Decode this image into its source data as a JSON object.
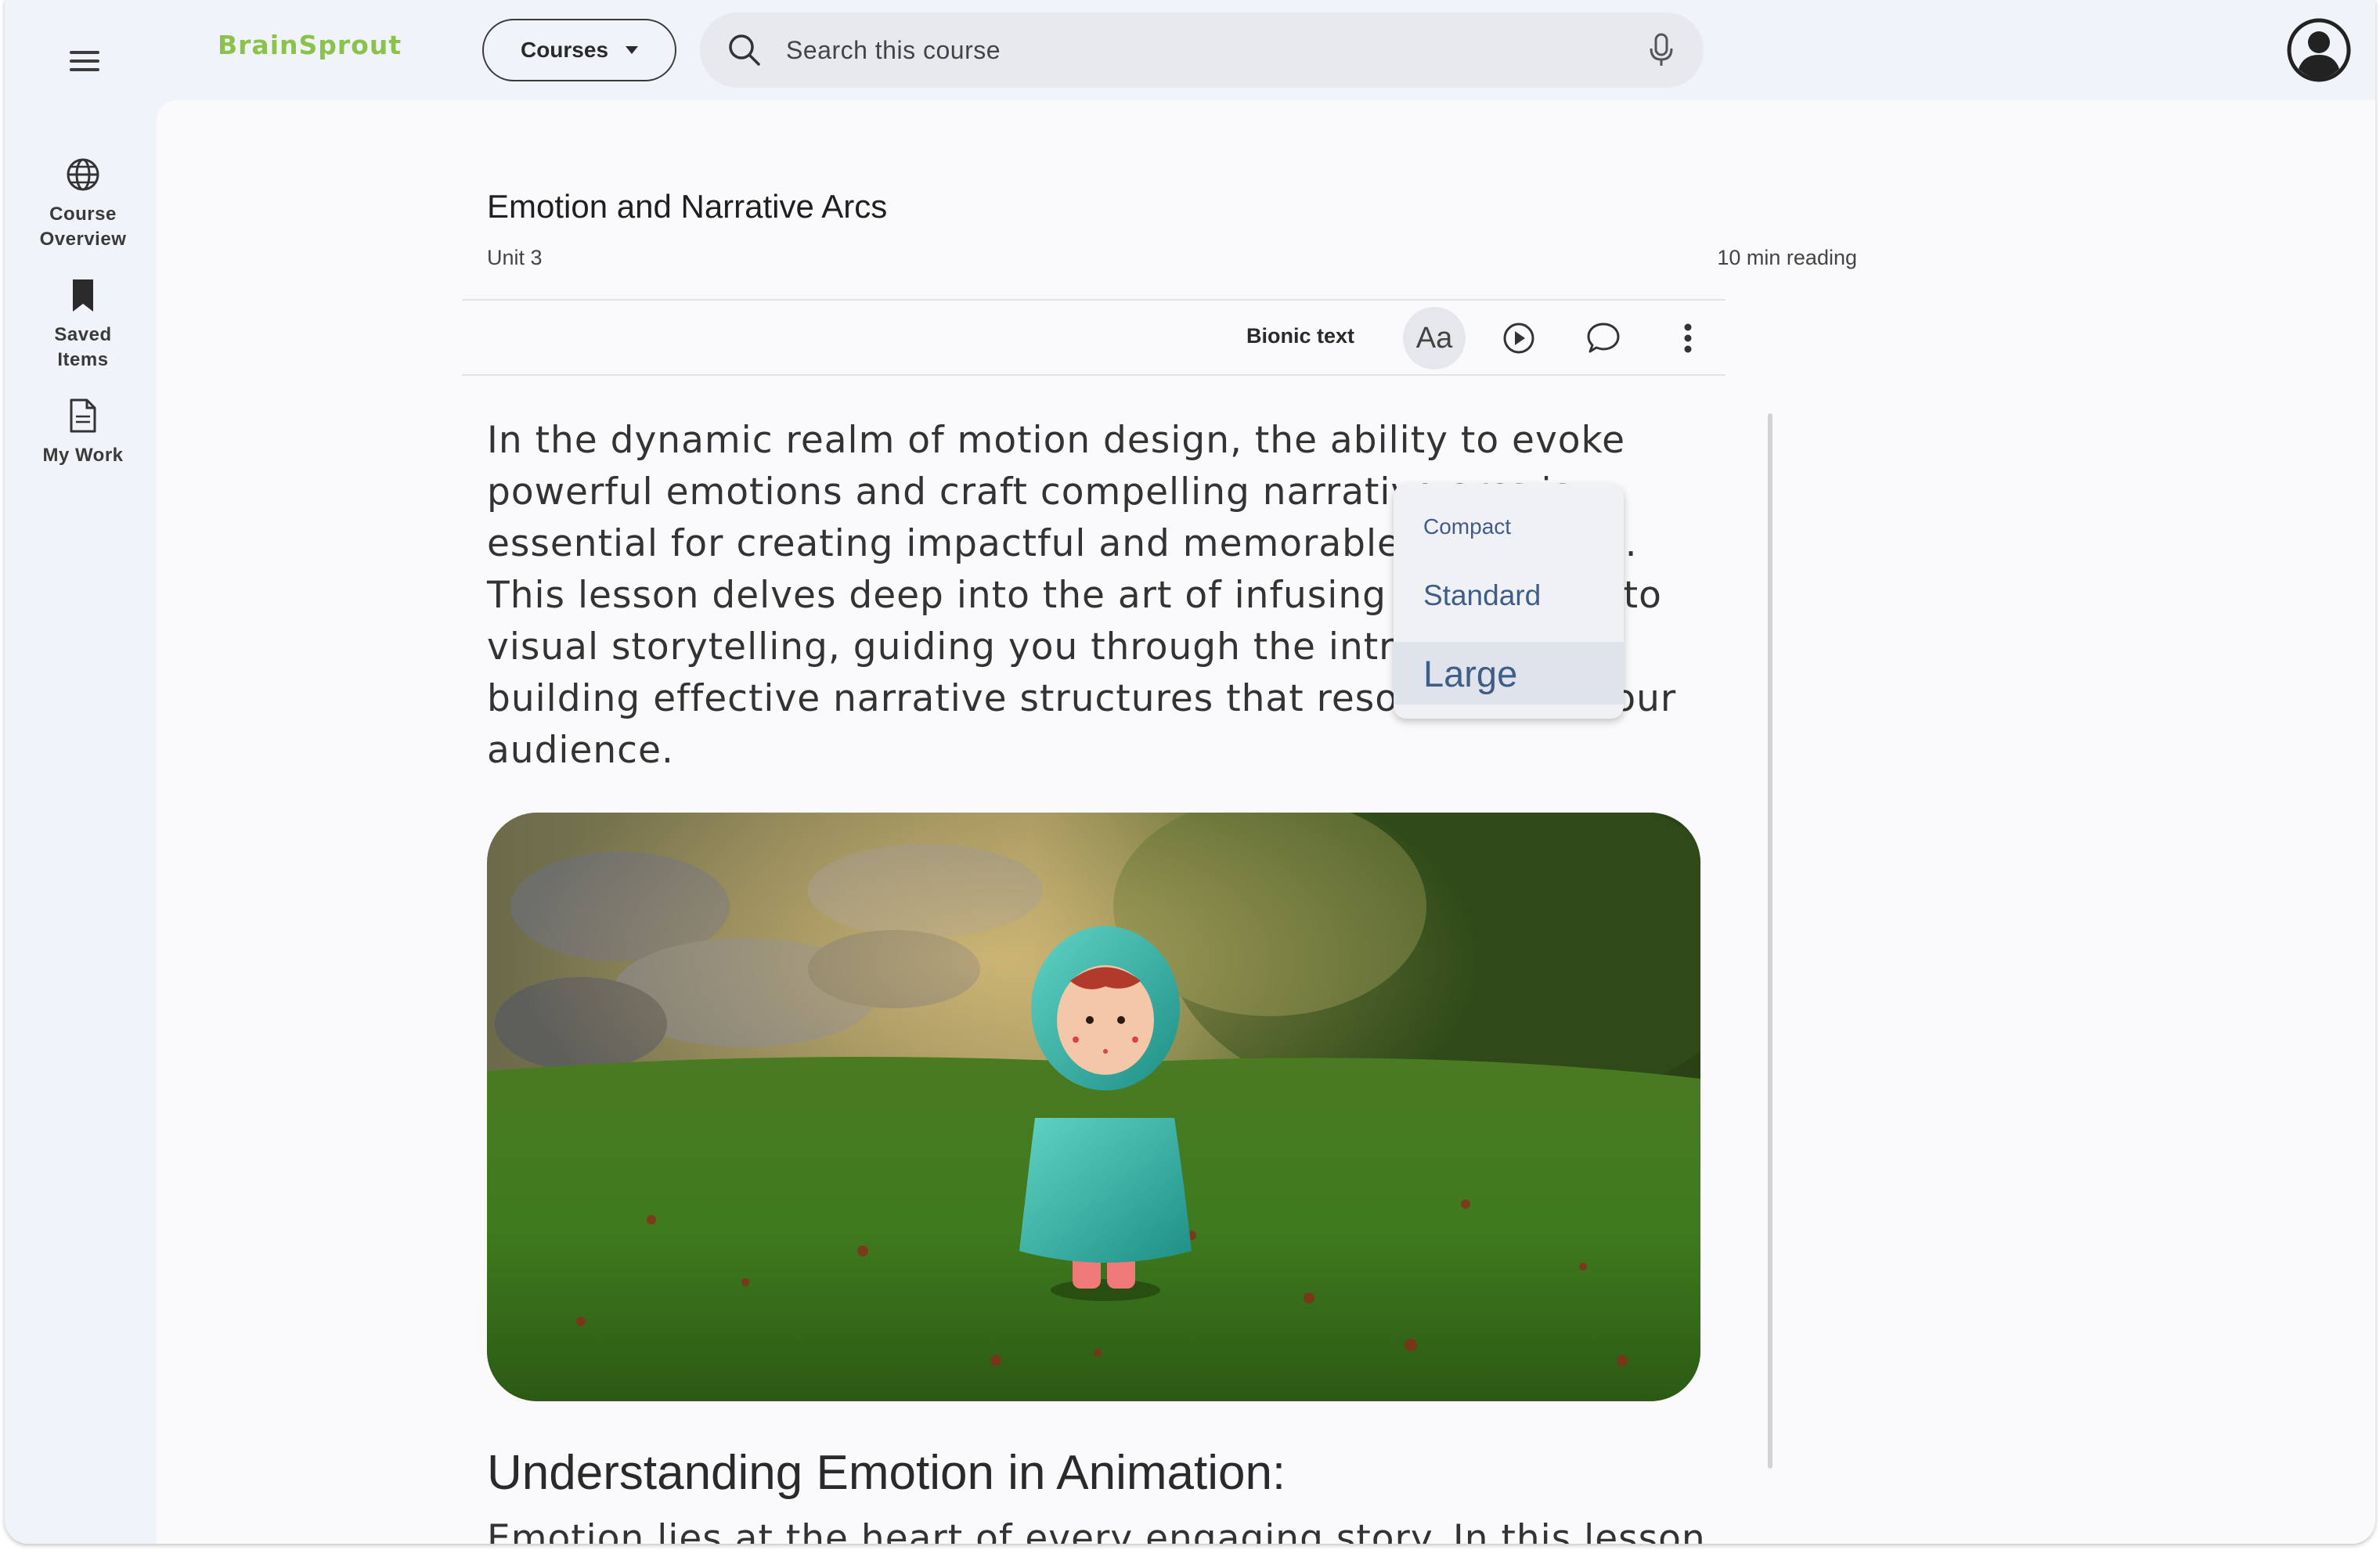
{
  "app": {
    "brand": "BrainSprout"
  },
  "header": {
    "courses_label": "Courses",
    "search": {
      "placeholder": "Search this course"
    }
  },
  "sidebar": {
    "items": [
      {
        "label": "Course Overview",
        "icon": "globe-icon"
      },
      {
        "label": "Saved Items",
        "icon": "bookmark-icon"
      },
      {
        "label": "My Work",
        "icon": "document-icon"
      }
    ]
  },
  "lesson": {
    "title": "Emotion and Narrative Arcs",
    "unit": "Unit 3",
    "reading_time": "10 min reading",
    "intro": "In the dynamic realm of motion design, the ability to evoke powerful emotions and craft compelling narrative arcs is essential for creating impactful and memorable animations. This lesson delves deep into the art of infusing emotions into visual storytelling, guiding you through the intricacies of building effective narrative structures that resonate with your audience.",
    "heading": "Understanding Emotion in Animation:",
    "next_paragraph_start": "Emotion lies at the heart of every engaging story. In this lesson"
  },
  "toolbar": {
    "bionic_label": "Bionic text",
    "text_size_label": "Aa"
  },
  "text_size_menu": {
    "options": [
      "Compact",
      "Standard",
      "Large"
    ],
    "selected": "Large"
  },
  "colors": {
    "brand": "#8bc34a",
    "menu_text": "#3f5d86",
    "background": "#f1f3fa"
  }
}
